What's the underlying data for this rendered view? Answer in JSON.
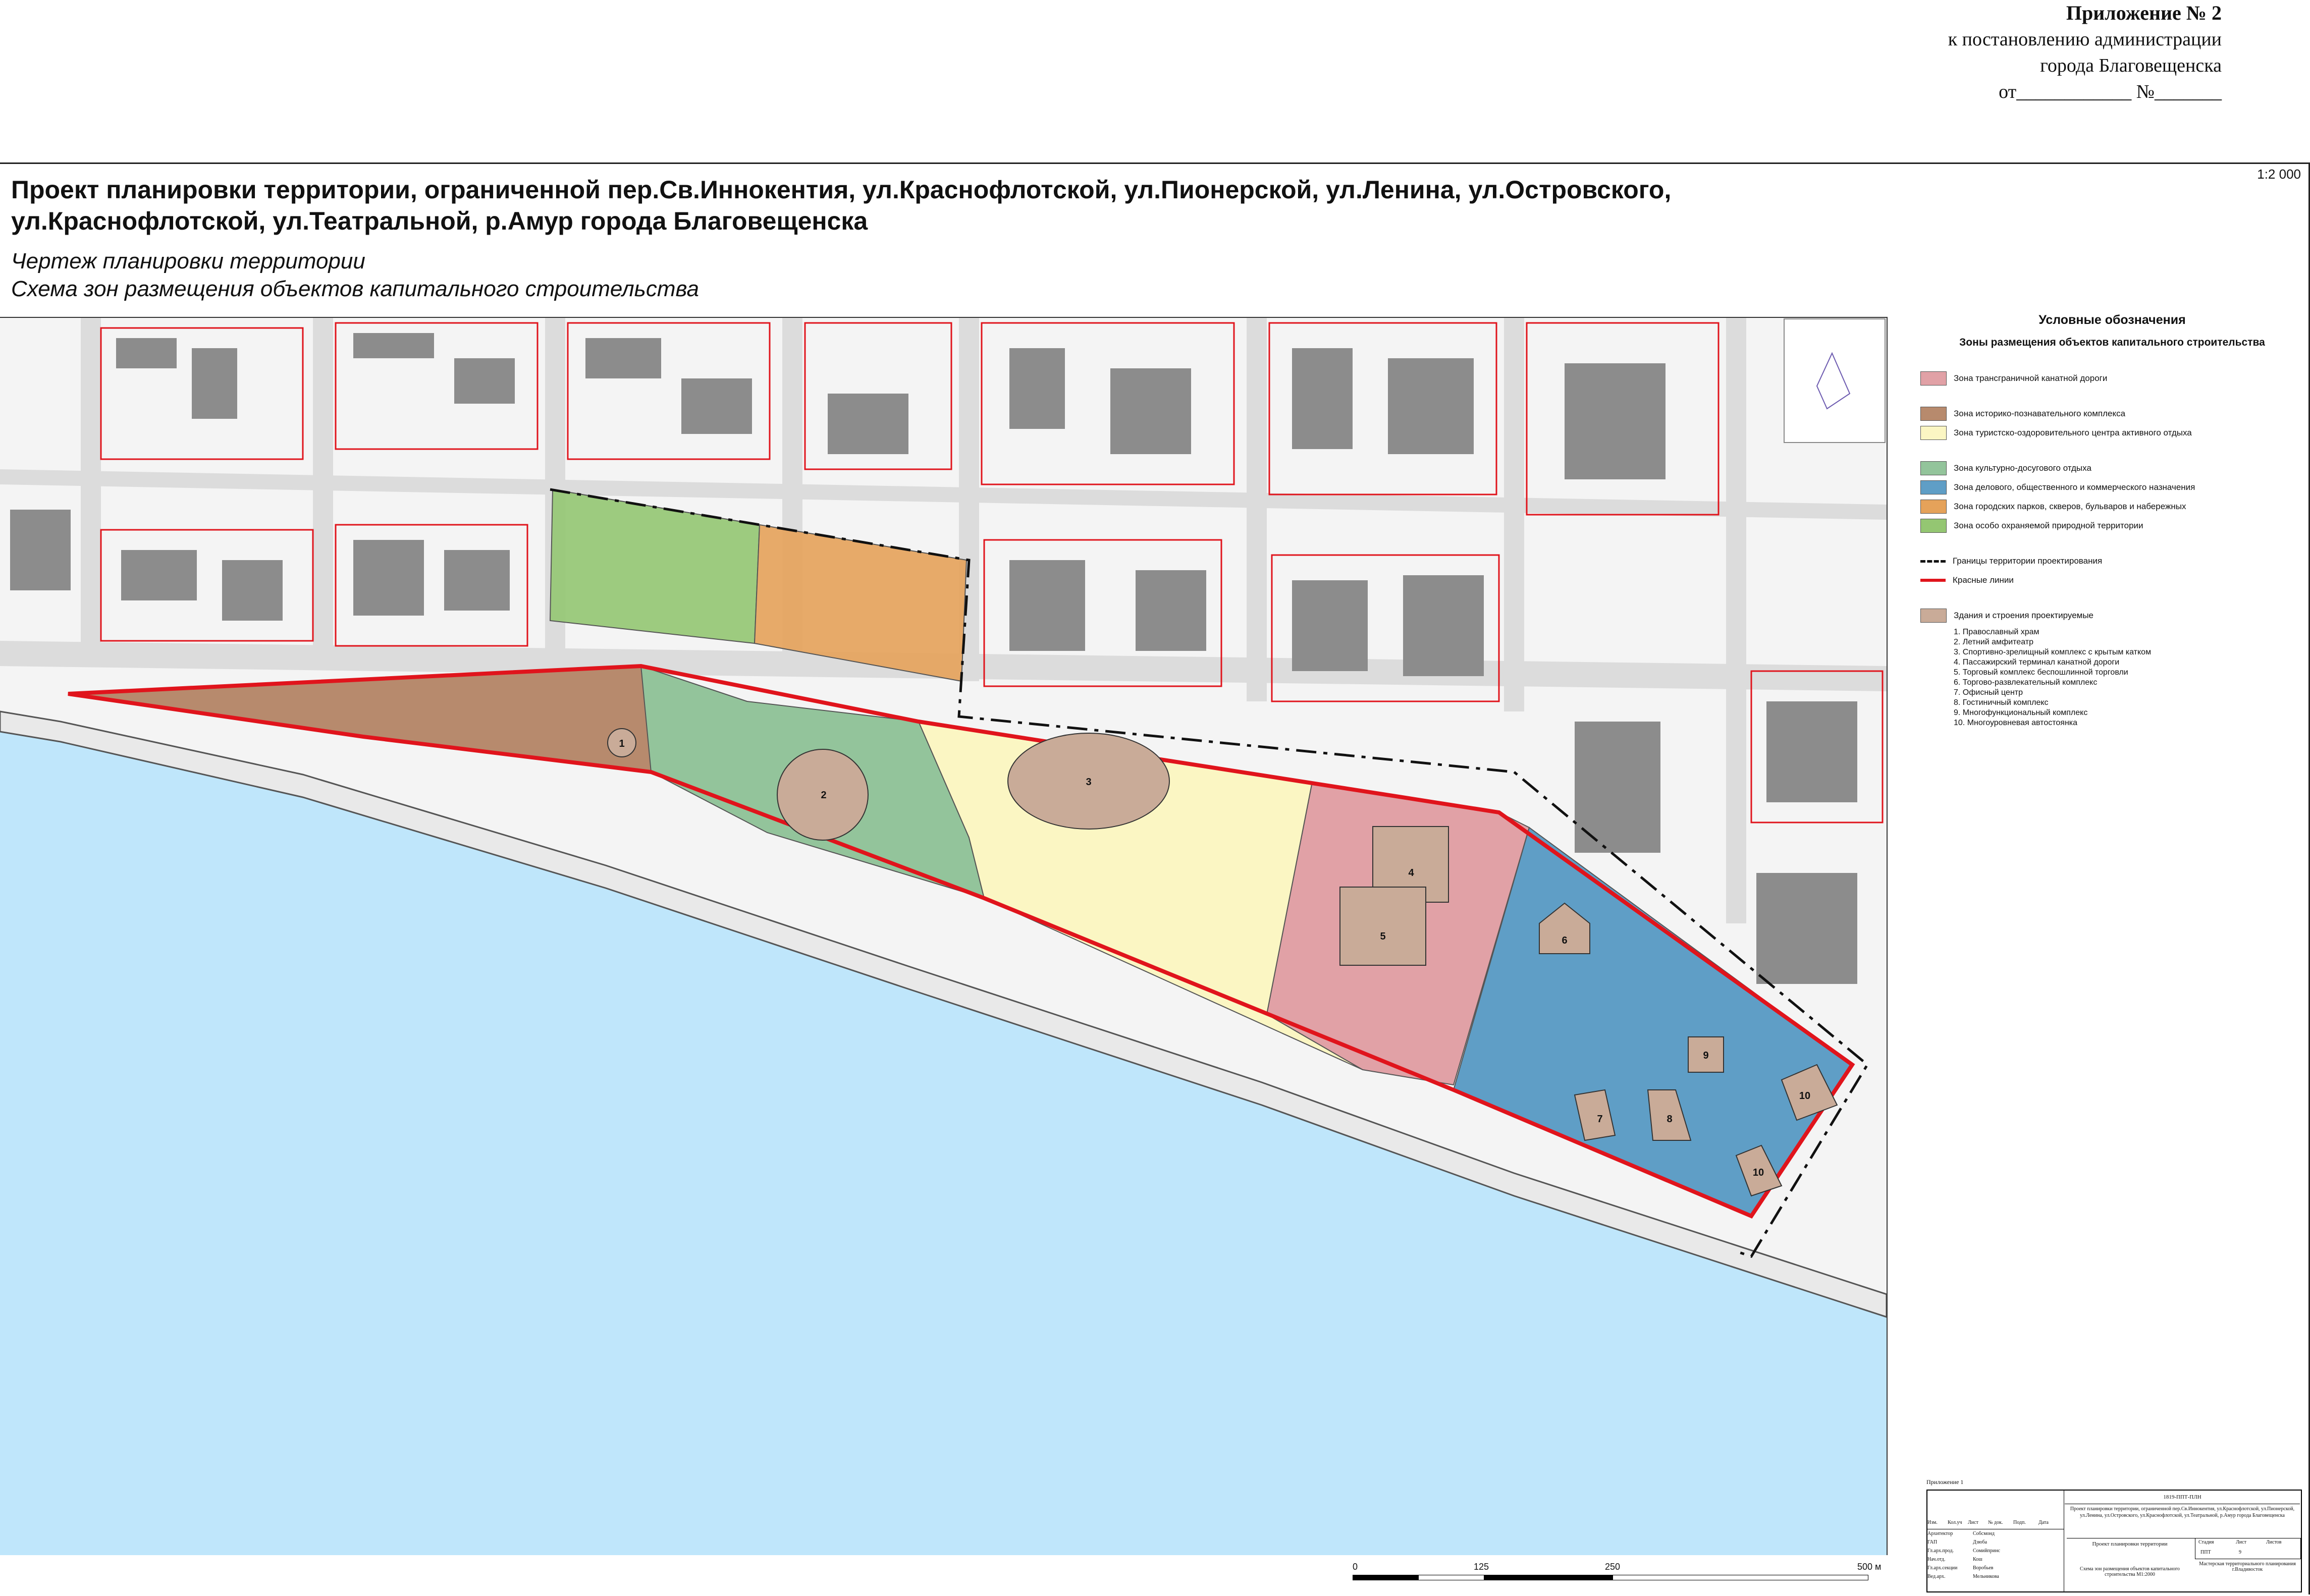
{
  "appendix": {
    "title": "Приложение № 2",
    "line1": "к постановлению администрации",
    "line2": "города Благовещенска",
    "line3": "от____________ №_______"
  },
  "scale": "1:2 000",
  "title": "Проект планировки территории, ограниченной пер.Св.Иннокентия, ул.Краснофлотской, ул.Пионерской, ул.Ленина, ул.Островского, ул.Краснофлотской, ул.Театральной, р.Амур города Благовещенска",
  "subtitle_1": "Чертеж планировки территории",
  "subtitle_2": "Схема зон размещения объектов капитального строительства",
  "legend": {
    "title": "Условные обозначения",
    "subtitle": "Зоны размещения объектов капитального строительства",
    "zones": [
      {
        "label": "Зона трансграничной канатной дороги",
        "color": "#e1a1a6"
      },
      {
        "label": "Зона историко-познавательного комплекса",
        "color": "#b78a6d"
      },
      {
        "label": "Зона туристско-оздоровительного центра активного отдыха",
        "color": "#fbf6c3"
      },
      {
        "label": "Зона культурно-досугового отдыха",
        "color": "#93c49b"
      },
      {
        "label": "Зона делового, общественного и коммерческого назначения",
        "color": "#5f9ec6"
      },
      {
        "label": "Зона городских парков, скверов, бульваров и набережных",
        "color": "#e5a25a"
      },
      {
        "label": "Зона особо охраняемой природной территории",
        "color": "#94c672"
      }
    ],
    "boundary_label": "Границы территории проектирования",
    "red_lines_label": "Красные линии",
    "buildings_label": "Здания и строения проектируемые",
    "buildings": [
      "1. Православный храм",
      "2. Летний амфитеатр",
      "3. Спортивно-зрелищный комплекс с крытым катком",
      "4. Пассажирский терминал канатной дороги",
      "5. Торговый комплекс беспошлинной торговли",
      "6. Торгово-развлекательный комплекс",
      "7. Офисный центр",
      "8. Гостиничный комплекс",
      "9. Многофункциональный комплекс",
      "10. Многоуровневая автостоянка"
    ]
  },
  "map_labels": {
    "b1": "1",
    "b2": "2",
    "b3": "3",
    "b4": "4",
    "b5": "5",
    "b6": "6",
    "b7": "7",
    "b8": "8",
    "b9": "9",
    "b10a": "10",
    "b10b": "10"
  },
  "colors": {
    "water": "#bfe6fb",
    "red_line": "#e0141c",
    "building_gray": "#8c8c8c",
    "building_project": "#c9ab98"
  },
  "scalebar": {
    "t0": "0",
    "t1": "125",
    "t2": "250",
    "t3": "500 м"
  },
  "stamp": {
    "appendix": "Приложение 1",
    "code": "1819-ППТ-ПЛН",
    "project": "Проект планировки территории, ограниченной пер.Св.Иннокентия, ул.Краснофлотской, ул.Пионерской, ул.Ленина, ул.Островского, ул.Краснофлотской, ул.Театральной, р.Амур города Благовещенска",
    "stage": "Проект планировки территории",
    "sheet_title": "Схема зон размещения объектов капитального строительства М1:2000",
    "stage_code": "ППТ",
    "sheet": "9",
    "org": "Мастерская территориального планирования г.Владивосток",
    "roles": [
      "Изм.",
      "Кол.уч",
      "Лист",
      "№ док.",
      "Подп.",
      "Дата"
    ],
    "staff": [
      {
        "role": "Архитектор",
        "name": "Собсмонд"
      },
      {
        "role": "ГАП",
        "name": "Дзюба"
      },
      {
        "role": "Гл.арх.прод.",
        "name": "Сомийпринс"
      },
      {
        "role": "Нач.отд.",
        "name": "Кош"
      },
      {
        "role": "Гл.арх.секции",
        "name": "Воробьев"
      },
      {
        "role": "Вед.арх.",
        "name": "Мельникова"
      }
    ],
    "stage_head": "Стадия",
    "sheet_head": "Лист",
    "sheets_head": "Листов"
  }
}
